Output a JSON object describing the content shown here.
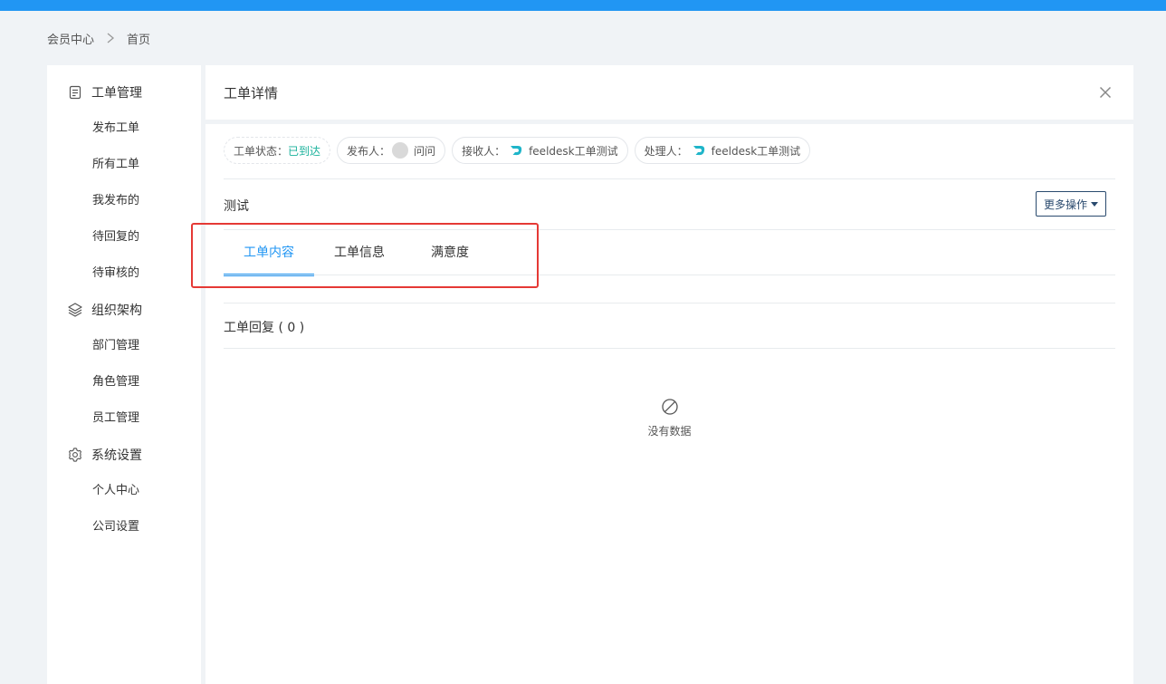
{
  "breadcrumb": {
    "root": "会员中心",
    "current": "首页"
  },
  "sidebar": {
    "groups": [
      {
        "label": "工单管理",
        "icon": "document-icon",
        "items": [
          "发布工单",
          "所有工单",
          "我发布的",
          "待回复的",
          "待审核的"
        ]
      },
      {
        "label": "组织架构",
        "icon": "layers-icon",
        "items": [
          "部门管理",
          "角色管理",
          "员工管理"
        ]
      },
      {
        "label": "系统设置",
        "icon": "gear-icon",
        "items": [
          "个人中心",
          "公司设置"
        ]
      }
    ]
  },
  "header": {
    "title": "工单详情",
    "close_icon": "close-icon"
  },
  "pills": {
    "status_label": "工单状态：",
    "status_value": "已到达",
    "status_color": "#19b19b",
    "publisher_label": "发布人：",
    "publisher_value": "问问",
    "receiver_label": "接收人：",
    "receiver_value": "feeldesk工单测试",
    "handler_label": "处理人：",
    "handler_value": "feeldesk工单测试"
  },
  "subject": "测试",
  "more_button": "更多操作",
  "tabs": [
    {
      "label": "工单内容",
      "active": true
    },
    {
      "label": "工单信息",
      "active": false
    },
    {
      "label": "满意度",
      "active": false
    }
  ],
  "reply": {
    "label": "工单回复 ( 0 )"
  },
  "empty": {
    "text": "没有数据",
    "icon": "no-data-icon"
  },
  "colors": {
    "accent": "#2196f3",
    "highlight": "#e53935"
  }
}
